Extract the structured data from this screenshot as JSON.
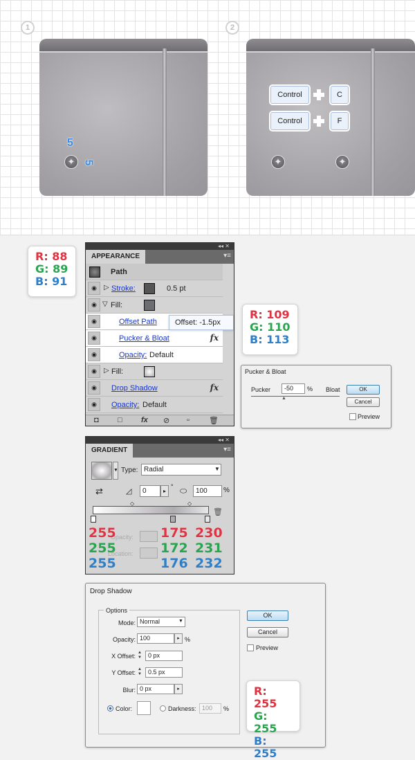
{
  "steps": [
    "1",
    "2"
  ],
  "step1": {
    "label_top": "5",
    "label_side": "5"
  },
  "keys": [
    {
      "key1": "Control",
      "key2": "C"
    },
    {
      "key1": "Control",
      "key2": "F"
    }
  ],
  "rgb_callouts": [
    {
      "r": "R: 88",
      "g": "G: 89",
      "b": "B: 91"
    },
    {
      "r": "R: 109",
      "g": "G: 110",
      "b": "B: 113"
    },
    {
      "r": "R: 255",
      "g": "G: 255",
      "b": "B: 255"
    }
  ],
  "appearance": {
    "title": "APPEARANCE",
    "controls": "◂◂ ✕",
    "menu": "▾≡",
    "object": "Path",
    "rows": [
      {
        "label": "Stroke:",
        "value": "0.5 pt",
        "swatch": "#555555"
      },
      {
        "label": "Fill:",
        "swatch": "#6d6e71"
      },
      {
        "label": "Offset Path"
      },
      {
        "label": "Pucker & Bloat",
        "fx": "fx"
      },
      {
        "label": "Opacity:",
        "value": "Default"
      },
      {
        "label": "Fill:"
      },
      {
        "label": "Drop Shadow",
        "fx": "fx"
      },
      {
        "label": "Opacity:",
        "value": "Default"
      }
    ],
    "tooltip": "Offset: -1.5px"
  },
  "pucker": {
    "title": "Pucker & Bloat",
    "left_label": "Pucker",
    "value": "-50",
    "unit": "%",
    "right_label": "Bloat",
    "ok": "OK",
    "cancel": "Cancel",
    "preview": "Preview"
  },
  "gradient": {
    "title": "GRADIENT",
    "type_label": "Type:",
    "type_value": "Radial",
    "angle": "0",
    "degree": "°",
    "aspect": "100",
    "percent": "%",
    "opacity_label": "Opacity:",
    "location_label": "Location:",
    "stops": [
      {
        "r": "255",
        "g": "255",
        "b": "255"
      },
      {
        "r": "175",
        "g": "172",
        "b": "176"
      },
      {
        "r": "230",
        "g": "231",
        "b": "232"
      }
    ]
  },
  "drop_shadow": {
    "title": "Drop Shadow",
    "group": "Options",
    "mode_label": "Mode:",
    "mode": "Normal",
    "opacity_label": "Opacity:",
    "opacity": "100",
    "opacity_unit": "%",
    "x_label": "X Offset:",
    "x": "0 px",
    "y_label": "Y Offset:",
    "y": "0.5 px",
    "blur_label": "Blur:",
    "blur": "0 px",
    "color_label": "Color:",
    "darkness_label": "Darkness:",
    "darkness": "100",
    "darkness_unit": "%",
    "ok": "OK",
    "cancel": "Cancel",
    "preview": "Preview"
  }
}
